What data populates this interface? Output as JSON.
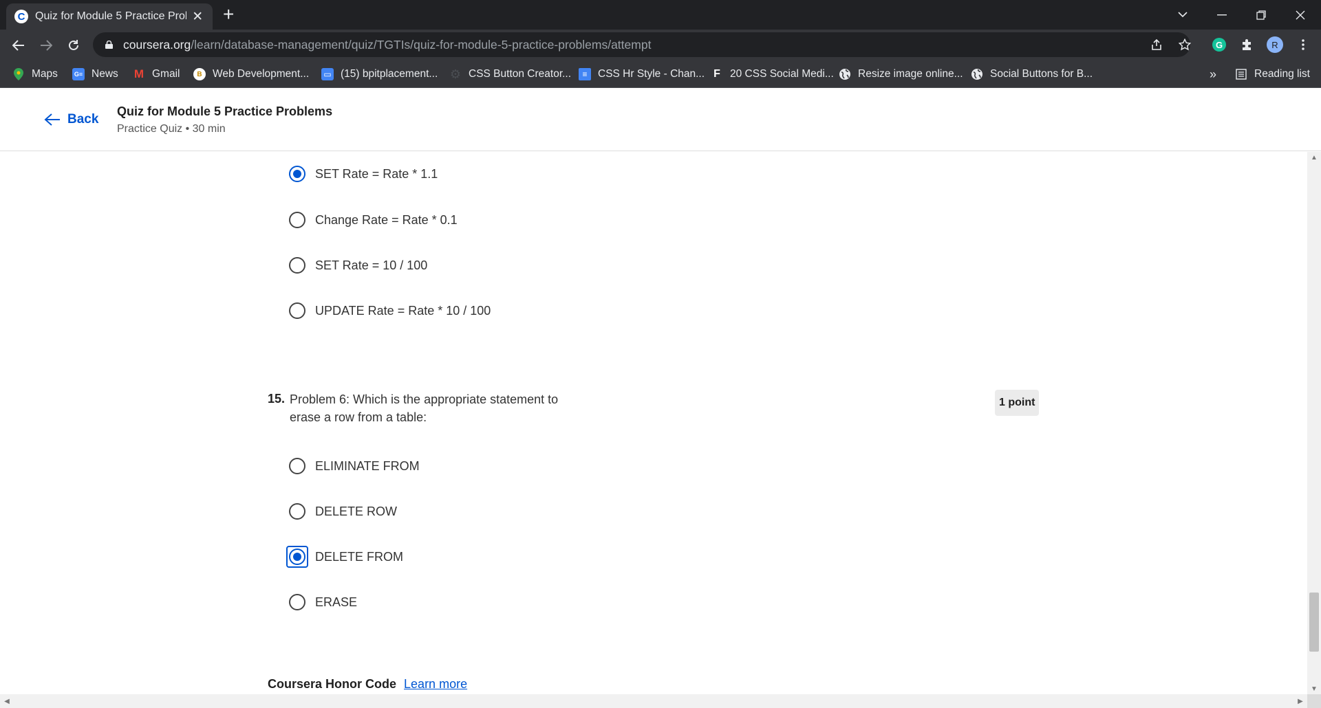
{
  "browser": {
    "tab_title": "Quiz for Module 5 Practice Problé",
    "tab_favicon_letter": "C",
    "url_host": "coursera.org",
    "url_path": "/learn/database-management/quiz/TGTIs/quiz-for-module-5-practice-problems/attempt",
    "profile_initial": "R",
    "bookmarks": [
      {
        "label": "Maps",
        "icon": "maps-pin-icon"
      },
      {
        "label": "News",
        "icon": "google-news-icon"
      },
      {
        "label": "Gmail",
        "icon": "gmail-icon"
      },
      {
        "label": "Web Development...",
        "icon": "web-dev-icon"
      },
      {
        "label": "(15) bpitplacement...",
        "icon": "chat-icon"
      },
      {
        "label": "CSS Button Creator...",
        "icon": "gear-icon"
      },
      {
        "label": "CSS Hr Style - Chan...",
        "icon": "doc-icon"
      },
      {
        "label": "20 CSS Social Medi...",
        "icon": "f-logo-icon"
      },
      {
        "label": "Resize image online...",
        "icon": "globe-icon"
      },
      {
        "label": "Social Buttons for B...",
        "icon": "globe-icon"
      }
    ],
    "overflow_label": "»",
    "reading_list": "Reading list"
  },
  "header": {
    "back_label": "Back",
    "title": "Quiz for Module 5 Practice Problems",
    "subtitle": "Practice Quiz • 30 min"
  },
  "prev_question": {
    "options": [
      {
        "label": "SET Rate = Rate * 1.1",
        "selected": true
      },
      {
        "label": "Change Rate = Rate * 0.1",
        "selected": false
      },
      {
        "label": "SET Rate = 10 / 100",
        "selected": false
      },
      {
        "label": "UPDATE Rate = Rate * 10 / 100",
        "selected": false
      }
    ]
  },
  "question": {
    "number": "15.",
    "text": "Problem 6: Which is the appropriate statement to erase a row from a table:",
    "points": "1 point",
    "options": [
      {
        "label": "ELIMINATE FROM",
        "selected": false
      },
      {
        "label": "DELETE ROW",
        "selected": false
      },
      {
        "label": "DELETE FROM",
        "selected": true
      },
      {
        "label": "ERASE",
        "selected": false
      }
    ]
  },
  "honor_code": {
    "title": "Coursera Honor Code",
    "link": "Learn more"
  },
  "colors": {
    "accent": "#0056d2",
    "chrome_dark": "#202124",
    "chrome_toolbar": "#35363a"
  }
}
